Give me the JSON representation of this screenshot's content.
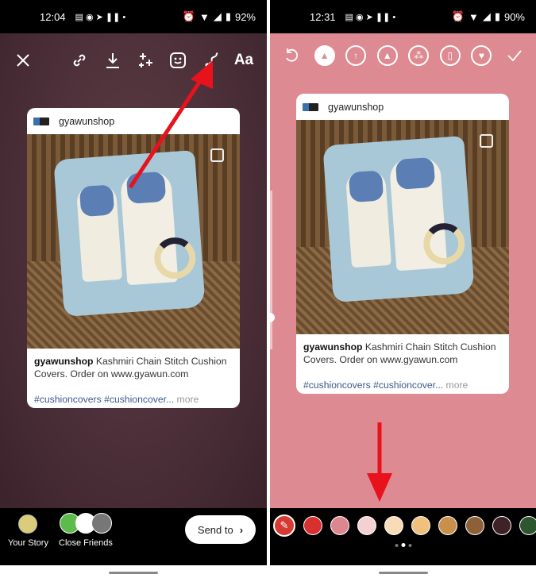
{
  "left": {
    "status": {
      "time": "12:04",
      "battery": "92%"
    },
    "toolbar": {
      "text_label": "Aa"
    },
    "card": {
      "username": "gyawunshop",
      "caption_user": "gyawunshop",
      "caption_text": " Kashmiri Chain Stitch Cushion Covers. Order on www.gyawun.com",
      "tags": "#cushioncovers #cushioncover...",
      "more": " more"
    },
    "bottom": {
      "your_story": "Your Story",
      "close_friends": "Close Friends",
      "send_to": "Send to"
    }
  },
  "right": {
    "status": {
      "time": "12:31",
      "battery": "90%"
    },
    "card": {
      "username": "gyawunshop",
      "caption_user": "gyawunshop",
      "caption_text": " Kashmiri Chain Stitch Cushion Covers. Order on www.gyawun.com",
      "tags": "#cushioncovers #cushioncover...",
      "more": " more"
    },
    "palette": [
      "#d8302e",
      "#dd8690",
      "#f5d0d3",
      "#f8dcb8",
      "#f0c07c",
      "#c8904a",
      "#8e6038",
      "#3e2226",
      "#2c5530"
    ],
    "page_indicator": {
      "pages": 3,
      "current": 2
    }
  },
  "colors": {
    "accent_red": "#e8121c",
    "story_bg": "#4a2e37",
    "draw_bg": "#de8a92"
  }
}
